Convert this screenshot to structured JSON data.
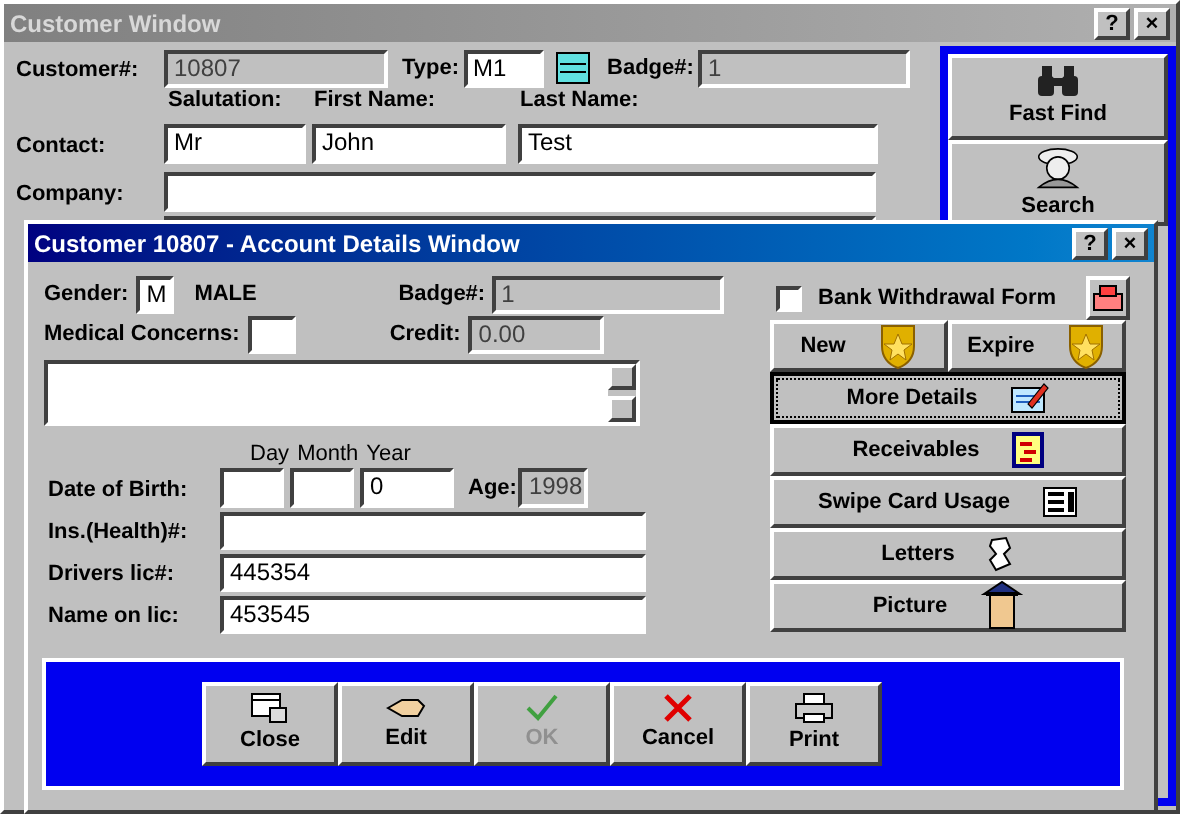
{
  "customer_window": {
    "title": "Customer Window",
    "controls": [
      "?",
      "×"
    ],
    "customer_label": "Customer#:",
    "customer_number": "10807",
    "type_label": "Type:",
    "type_value": "M1",
    "badge_label": "Badge#:",
    "badge_value": "1",
    "contact_headers": [
      "Salutation:",
      "First Name:",
      "Last Name:"
    ],
    "contact_label": "Contact:",
    "salutation": "Mr",
    "first_name": "John",
    "last_name": "Test",
    "company_label": "Company:",
    "side_buttons": [
      {
        "label": "Fast Find",
        "kind": "binoculars"
      },
      {
        "label": "Search",
        "kind": "detective"
      }
    ]
  },
  "account_window": {
    "title": "Customer 10807 - Account Details Window",
    "controls": [
      "?",
      "×"
    ],
    "gender_label": "Gender:",
    "gender": "M",
    "gender_text": "MALE",
    "badge_label": "Badge#:",
    "badge_value": "1",
    "medical_label": "Medical Concerns:",
    "credit_label": "Credit:",
    "credit": "0.00",
    "dob_label": "Date of Birth:",
    "dob_headers": [
      "Day",
      "Month",
      "Year"
    ],
    "year": "0",
    "age_label": "Age:",
    "age": "1998",
    "ins_label": "Ins.(Health)#:",
    "drivers_label": "Drivers lic#:",
    "drivers_lic": "445354",
    "name_label": "Name on lic:",
    "name_on_lic": "453545",
    "bank_withdrawal": {
      "label": "Bank Withdrawal Form",
      "checked": false
    },
    "action_buttons": [
      {
        "label": "New",
        "kind": "shield",
        "focused": false
      },
      {
        "label": "Expire",
        "kind": "shield",
        "focused": false
      },
      {
        "label": "More Details",
        "kind": "notepad",
        "focused": true
      },
      {
        "label": "Receivables",
        "kind": "document",
        "focused": false
      },
      {
        "label": "Swipe Card Usage",
        "kind": "list",
        "focused": false
      },
      {
        "label": "Letters",
        "kind": "scroll",
        "focused": false
      },
      {
        "label": "Picture",
        "kind": "figure",
        "focused": false
      }
    ],
    "bottom_buttons": [
      {
        "label": "Close",
        "kind": "windows",
        "disabled": false
      },
      {
        "label": "Edit",
        "kind": "pen",
        "disabled": false
      },
      {
        "label": "OK",
        "kind": "check",
        "disabled": true
      },
      {
        "label": "Cancel",
        "kind": "cross",
        "disabled": false
      },
      {
        "label": "Print",
        "kind": "printer",
        "disabled": false
      }
    ]
  }
}
